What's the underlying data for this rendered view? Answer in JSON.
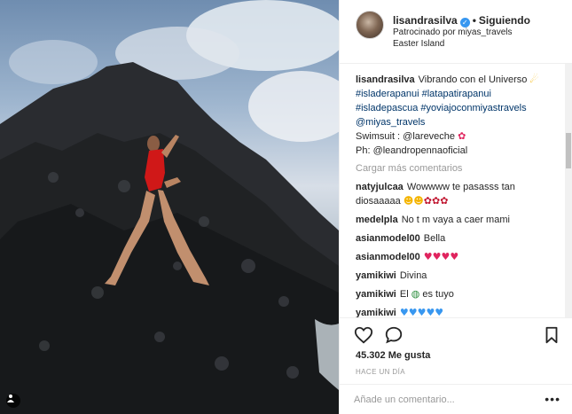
{
  "header": {
    "username": "lisandrasilva",
    "separator": "•",
    "follow_status": "Siguiendo",
    "sponsored": "Patrocinado por miyas_travels",
    "location": "Easter Island"
  },
  "caption": {
    "username": "lisandrasilva",
    "text": "Vibrando con el Universo",
    "emoji": "☄",
    "hashtags_line1": "#isladerapanui #latapatirapanui",
    "hashtags_line2": "#isladepascua #yoviajoconmiyastravels",
    "mention": "@miyas_travels",
    "swimsuit": "Swimsuit : @lareveche",
    "swimsuit_emoji": "✿",
    "photo": "Ph: @leandropennaoficial"
  },
  "load_more": "Cargar más comentarios",
  "comments": [
    {
      "user": "natyjulcaa",
      "text": "Wowwww te pasasss tan",
      "text2": "diosaaaaa",
      "emoji": "☻☻",
      "emoji2": "✿✿✿"
    },
    {
      "user": "medelpla",
      "text": "No t m vaya a caer mami"
    },
    {
      "user": "asianmodel00",
      "text": "Bella"
    },
    {
      "user": "asianmodel00",
      "text": "",
      "emoji": "♥♥♥♥"
    },
    {
      "user": "yamikiwi",
      "text": "Divina"
    },
    {
      "user": "yamikiwi",
      "text": "El",
      "emoji": "◍",
      "text_after": "es tuyo"
    },
    {
      "user": "yamikiwi",
      "text": "",
      "emoji": "♥♥♥♥♥"
    }
  ],
  "likes": "45.302 Me gusta",
  "time": "HACE UN DÍA",
  "add_comment": {
    "placeholder": "Añade un comentario..."
  },
  "more_options": "•••",
  "icons": {
    "like": "heart-icon",
    "comment": "comment-icon",
    "save": "bookmark-icon",
    "verified": "verified-badge-icon",
    "tag_people": "person-icon"
  },
  "colors": {
    "link": "#003569",
    "verified": "#3897f0",
    "muted": "#999999",
    "heart": "#e0245e"
  }
}
